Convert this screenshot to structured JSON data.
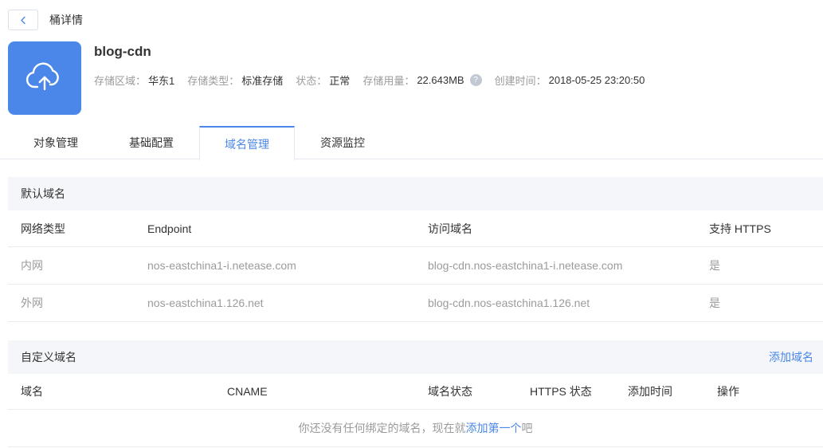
{
  "topbar": {
    "title": "桶详情"
  },
  "bucket": {
    "name": "blog-cdn",
    "info": [
      {
        "label": "存储区域：",
        "value": "华东1"
      },
      {
        "label": "存储类型：",
        "value": "标准存储"
      },
      {
        "label": "状态：",
        "value": "正常"
      },
      {
        "label": "存储用量：",
        "value": "22.643MB"
      },
      {
        "label": "创建时间：",
        "value": "2018-05-25 23:20:50"
      }
    ],
    "usage_help_glyph": "?"
  },
  "tabs": [
    {
      "label": "对象管理",
      "active": false
    },
    {
      "label": "基础配置",
      "active": false
    },
    {
      "label": "域名管理",
      "active": true
    },
    {
      "label": "资源监控",
      "active": false
    }
  ],
  "default_domains": {
    "section_title": "默认域名",
    "headers": [
      "网络类型",
      "Endpoint",
      "访问域名",
      "支持 HTTPS"
    ],
    "rows": [
      {
        "network_type": "内网",
        "endpoint": "nos-eastchina1-i.netease.com",
        "access_domain": "blog-cdn.nos-eastchina1-i.netease.com",
        "https": "是"
      },
      {
        "network_type": "外网",
        "endpoint": "nos-eastchina1.126.net",
        "access_domain": "blog-cdn.nos-eastchina1.126.net",
        "https": "是"
      }
    ]
  },
  "custom_domains": {
    "section_title": "自定义域名",
    "add_link_label": "添加域名",
    "headers": [
      "域名",
      "CNAME",
      "域名状态",
      "HTTPS 状态",
      "添加时间",
      "操作"
    ],
    "empty_state": {
      "text_before": "你还没有任何绑定的域名，现在就",
      "link_text": "添加第一个",
      "text_after": "吧"
    }
  },
  "colors": {
    "accent_blue": "#4a87e8",
    "text_dark": "#333333",
    "text_gray": "#9b9b9b",
    "section_bar_bg": "#f4f6f9",
    "border": "#e9edf2"
  }
}
